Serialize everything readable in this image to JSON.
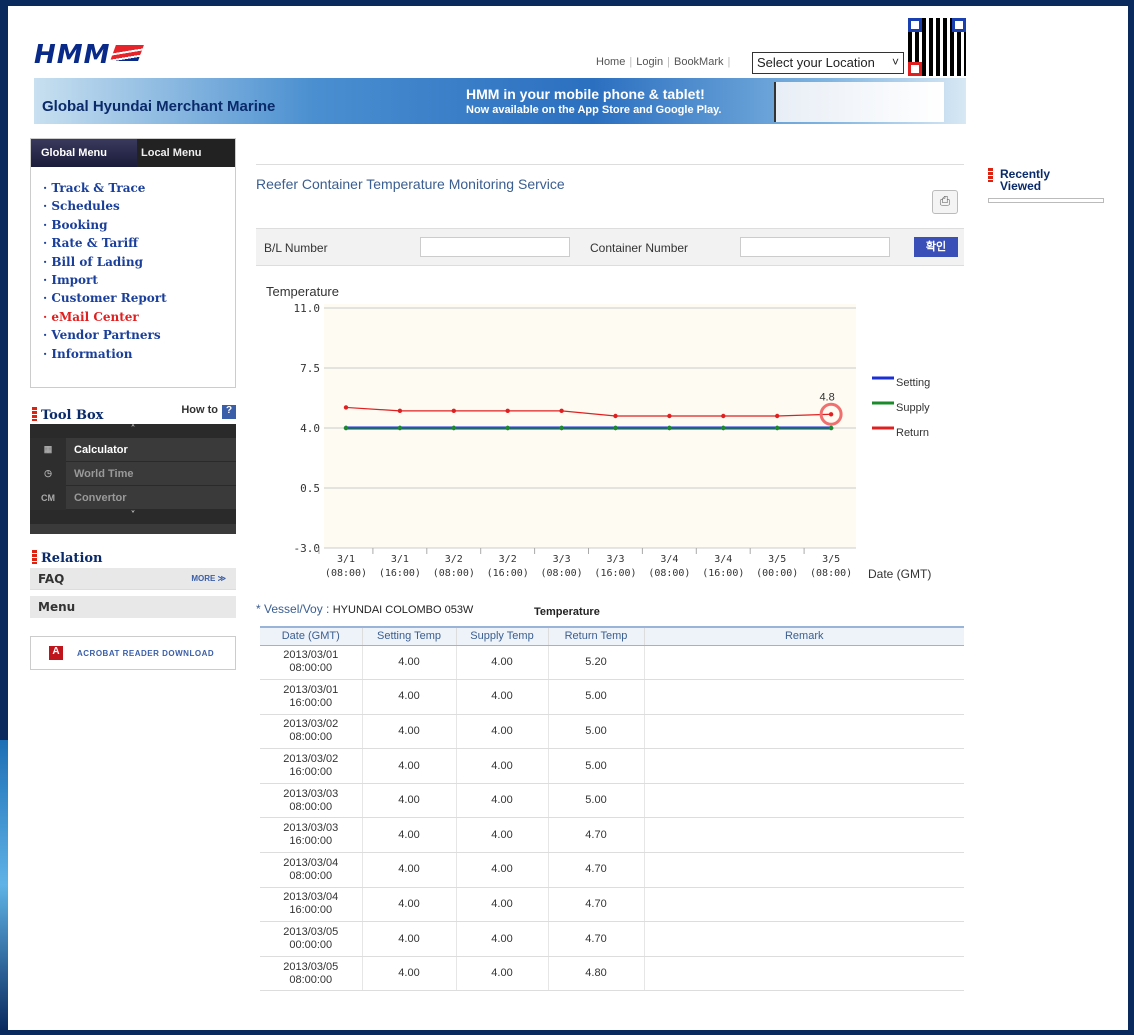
{
  "header": {
    "logo": "HMM",
    "nav": [
      "Home",
      "Login",
      "BookMark"
    ],
    "location_select": "Select your Location"
  },
  "banner": {
    "title": "Global Hyundai Merchant Marine",
    "line1": "HMM in your mobile phone & tablet!",
    "line2": "Now available on the App Store and Google Play."
  },
  "left_menu": {
    "tab_global": "Global Menu",
    "tab_local": "Local Menu",
    "items": [
      "· Track & Trace",
      "· Schedules",
      "· Booking",
      "· Rate & Tariff",
      "· Bill of Lading",
      "· Import",
      "· Customer Report",
      "· eMail Center",
      "· Vendor Partners",
      "· Information"
    ]
  },
  "toolbox": {
    "title": "Tool Box",
    "howto": "How to",
    "items": [
      "Calculator",
      "World Time",
      "Convertor"
    ]
  },
  "relation": {
    "title": "Relation",
    "faq": "FAQ",
    "more": "MORE ≫",
    "menu": "Menu"
  },
  "acrobat": "ACROBAT READER DOWNLOAD",
  "page_title": "Reefer Container Temperature Monitoring Service",
  "search": {
    "bl_label": "B/L Number",
    "container_label": "Container Number",
    "confirm": "확인"
  },
  "recently_viewed": "Recently Viewed",
  "chart_data": {
    "type": "line",
    "ylabel": "Temperature",
    "xlabel": "Date (GMT)",
    "ylim": [
      -3.0,
      11.0
    ],
    "yticks": [
      "11.0",
      "7.5",
      "4.0",
      "0.5",
      "-3.0"
    ],
    "categories": [
      "3/1\n(08:00)",
      "3/1\n(16:00)",
      "3/2\n(08:00)",
      "3/2\n(16:00)",
      "3/3\n(08:00)",
      "3/3\n(16:00)",
      "3/4\n(08:00)",
      "3/4\n(16:00)",
      "3/5\n(00:00)",
      "3/5\n(08:00)"
    ],
    "series": [
      {
        "name": "Setting",
        "color": "#1a2fd8",
        "values": [
          4.0,
          4.0,
          4.0,
          4.0,
          4.0,
          4.0,
          4.0,
          4.0,
          4.0,
          4.0
        ]
      },
      {
        "name": "Supply",
        "color": "#1a8a2a",
        "values": [
          4.0,
          4.0,
          4.0,
          4.0,
          4.0,
          4.0,
          4.0,
          4.0,
          4.0,
          4.0
        ]
      },
      {
        "name": "Return",
        "color": "#e02020",
        "values": [
          5.2,
          5.0,
          5.0,
          5.0,
          5.0,
          4.7,
          4.7,
          4.7,
          4.7,
          4.8
        ]
      }
    ],
    "annotation": "4.8"
  },
  "vessel": {
    "label": "Vessel/Voy :",
    "value": "HYUNDAI COLOMBO 053W",
    "temp_label": "Temperature"
  },
  "table": {
    "headers": [
      "Date (GMT)",
      "Setting Temp",
      "Supply Temp",
      "Return Temp",
      "Remark"
    ],
    "rows": [
      [
        "2013/03/01",
        "08:00:00",
        "4.00",
        "4.00",
        "5.20",
        ""
      ],
      [
        "2013/03/01",
        "16:00:00",
        "4.00",
        "4.00",
        "5.00",
        ""
      ],
      [
        "2013/03/02",
        "08:00:00",
        "4.00",
        "4.00",
        "5.00",
        ""
      ],
      [
        "2013/03/02",
        "16:00:00",
        "4.00",
        "4.00",
        "5.00",
        ""
      ],
      [
        "2013/03/03",
        "08:00:00",
        "4.00",
        "4.00",
        "5.00",
        ""
      ],
      [
        "2013/03/03",
        "16:00:00",
        "4.00",
        "4.00",
        "4.70",
        ""
      ],
      [
        "2013/03/04",
        "08:00:00",
        "4.00",
        "4.00",
        "4.70",
        ""
      ],
      [
        "2013/03/04",
        "16:00:00",
        "4.00",
        "4.00",
        "4.70",
        ""
      ],
      [
        "2013/03/05",
        "00:00:00",
        "4.00",
        "4.00",
        "4.70",
        ""
      ],
      [
        "2013/03/05",
        "08:00:00",
        "4.00",
        "4.00",
        "4.80",
        ""
      ]
    ]
  }
}
